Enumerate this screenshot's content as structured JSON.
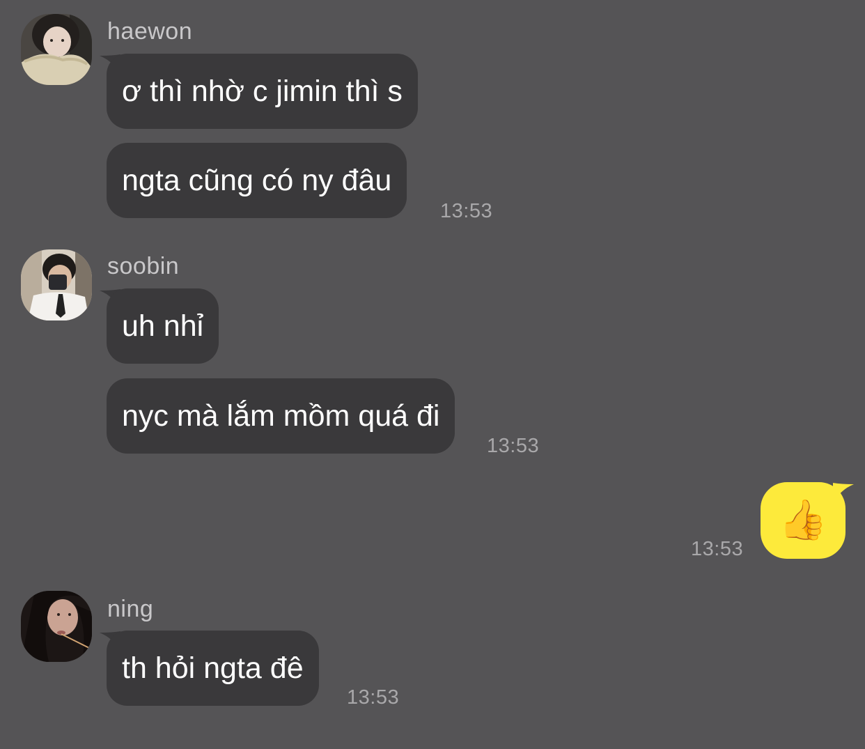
{
  "chat": {
    "groups": [
      {
        "sender": "haewon",
        "messages": [
          "ơ thì nhờ c jimin thì s",
          "ngta cũng có ny đâu"
        ],
        "time": "13:53"
      },
      {
        "sender": "soobin",
        "messages": [
          "uh nhỉ",
          "nyc mà lắm mồm quá đi"
        ],
        "time": "13:53"
      },
      {
        "sender": "ning",
        "messages": [
          "th hỏi ngta đê"
        ],
        "time": "13:53"
      }
    ],
    "my_message": {
      "emoji": "👍",
      "time": "13:53"
    },
    "colors": {
      "background": "#555456",
      "incoming_bubble": "#3a393b",
      "outgoing_bubble": "#fdea3b"
    }
  }
}
